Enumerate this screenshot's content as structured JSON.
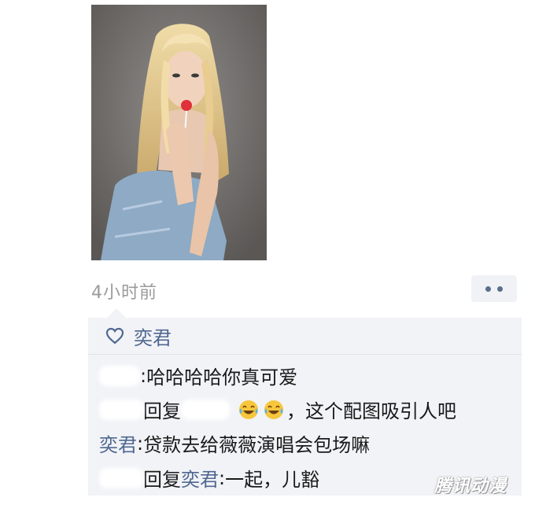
{
  "post": {
    "time": "4小时前",
    "image_alt": "blonde woman holding lollipop"
  },
  "likes": {
    "icon": "heart-icon",
    "users": "奕君"
  },
  "comments": [
    {
      "user": "",
      "sep": ": ",
      "text": "哈哈哈哈你真可爱"
    },
    {
      "user": "",
      "reply_word": "回复",
      "reply_to": "",
      "text": "，这个配图吸引人吧",
      "emoji": [
        "tears-of-joy-emoji",
        "tears-of-joy-emoji"
      ]
    },
    {
      "user": "奕君",
      "sep": ": ",
      "text": "贷款去给薇薇演唱会包场嘛"
    },
    {
      "user": "",
      "reply_word": "回复",
      "reply_to": "奕君",
      "sep": ": ",
      "text": "一起，儿豁"
    }
  ],
  "watermark": "腾讯动漫",
  "colors": {
    "link": "#4f6790",
    "panel": "#f2f3f7",
    "time": "#9b9b9b"
  }
}
